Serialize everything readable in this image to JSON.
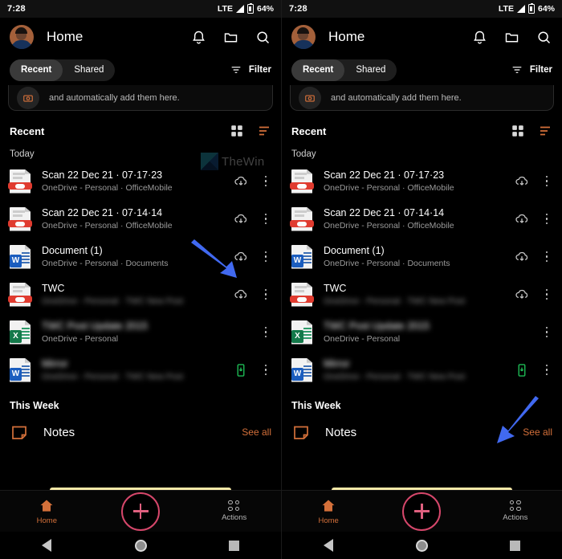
{
  "status_bar": {
    "time": "7:28",
    "network": "LTE",
    "battery_percent": "64%",
    "signal_icon": "signal-triangle-icon",
    "battery_icon": "battery-icon"
  },
  "app_bar": {
    "title": "Home",
    "avatar_icon": "user-avatar",
    "icons": [
      {
        "name": "notifications-bell-icon",
        "label": "Notifications"
      },
      {
        "name": "folder-icon",
        "label": "My files"
      },
      {
        "name": "search-icon",
        "label": "Search"
      }
    ]
  },
  "sub_bar": {
    "tabs": [
      {
        "label": "Recent",
        "active": true
      },
      {
        "label": "Shared",
        "active": false
      }
    ],
    "filter_label": "Filter",
    "filter_icon": "filter-funnel-icon"
  },
  "promo_card": {
    "text": "and automatically add them here.",
    "badge_icon": "camera-upload-icon"
  },
  "section": {
    "title": "Recent",
    "grid_view_icon": "grid-view-icon",
    "list_view_icon": "list-sort-icon",
    "subgroup": "Today"
  },
  "files": [
    {
      "name": "Scan 22 Dec 21 · 07·17·23",
      "subtitle": "OneDrive - Personal · OfficeMobile",
      "type": "pdf",
      "type_icon": "pdf-file-icon",
      "sync_icon": "cloud-download-icon",
      "sync_state": "cloud",
      "blurred_name": false,
      "blurred_subtitle": false
    },
    {
      "name": "Scan 22 Dec 21 · 07·14·14",
      "subtitle": "OneDrive - Personal · OfficeMobile",
      "type": "pdf",
      "type_icon": "pdf-file-icon",
      "sync_icon": "cloud-download-icon",
      "sync_state": "cloud",
      "blurred_name": false,
      "blurred_subtitle": false
    },
    {
      "name": "Document (1)",
      "subtitle": "OneDrive - Personal · Documents",
      "type": "word",
      "type_icon": "word-file-icon",
      "sync_icon": "cloud-download-icon",
      "sync_state": "cloud",
      "blurred_name": false,
      "blurred_subtitle": false
    },
    {
      "name": "TWC",
      "subtitle": "OneDrive - Personal · TWC New Post",
      "type": "pdf",
      "type_icon": "pdf-file-icon",
      "sync_icon": "cloud-download-icon",
      "sync_state": "cloud",
      "blurred_name": false,
      "blurred_subtitle": true
    },
    {
      "name": "TWC Post Update 2015",
      "subtitle": "OneDrive - Personal",
      "type": "excel",
      "type_icon": "excel-file-icon",
      "sync_icon": "",
      "sync_state": "none",
      "blurred_name": true,
      "blurred_subtitle": false
    },
    {
      "name": "Mirror",
      "subtitle": "OneDrive - Personal · TWC New Post",
      "type": "word",
      "type_icon": "word-file-icon",
      "sync_icon": "device-downloaded-icon",
      "sync_state": "downloaded",
      "blurred_name": true,
      "blurred_subtitle": true
    }
  ],
  "this_week": {
    "title": "This Week",
    "notes_label": "Notes",
    "notes_icon": "note-icon",
    "see_all_label": "See all"
  },
  "bottom_nav": {
    "items": [
      {
        "label": "Home",
        "icon": "home-icon",
        "active": true
      },
      {
        "label": "",
        "icon": "add-plus-fab",
        "active": false
      },
      {
        "label": "Actions",
        "icon": "actions-dots-icon",
        "active": false
      }
    ]
  },
  "system_nav": {
    "back_icon": "android-back-icon",
    "home_icon": "android-home-icon",
    "recents_icon": "android-recents-icon"
  },
  "watermark": {
    "text": "TheWin",
    "logo_icon": "thewindowsclub-logo"
  },
  "annotations": [
    {
      "panel": "left",
      "name": "arrow-pointing-to-cloud-download-icon",
      "direction": "down-right",
      "color": "#4169f0"
    },
    {
      "panel": "right",
      "name": "arrow-pointing-to-downloaded-icon",
      "direction": "up-right",
      "color": "#4169f0"
    }
  ],
  "colors": {
    "accent": "#d4703a",
    "fab": "#d6476b",
    "arrow": "#4169f0",
    "note_card": "#f7e9a8"
  }
}
